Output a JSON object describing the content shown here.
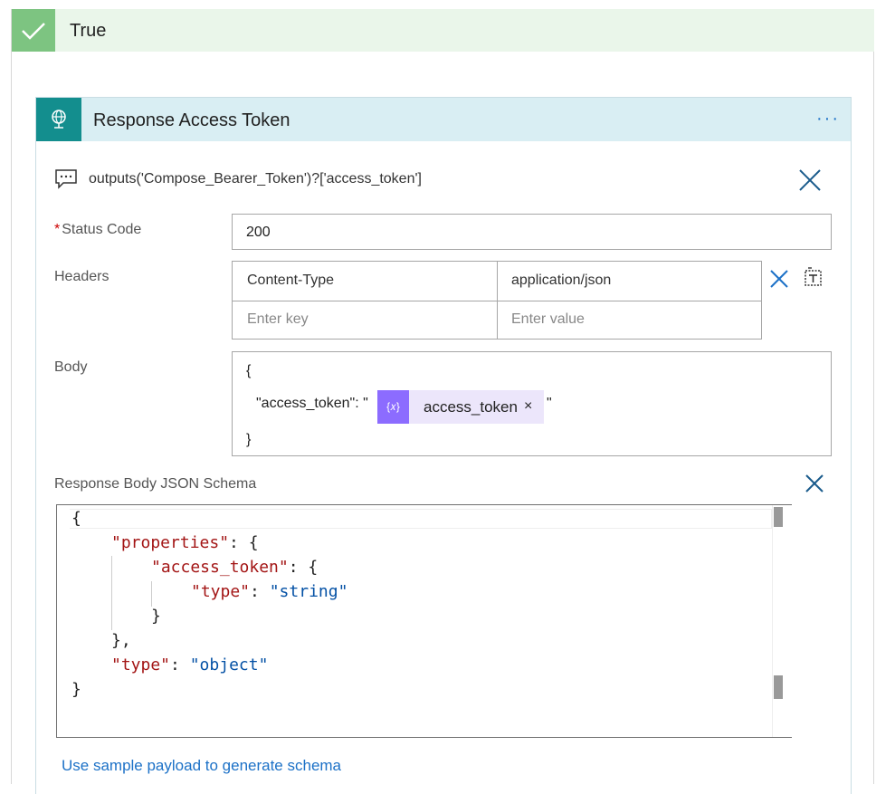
{
  "condition": {
    "label": "True"
  },
  "action": {
    "title": "Response Access Token",
    "menu": "···",
    "comment": "outputs('Compose_Bearer_Token')?['access_token']"
  },
  "fields": {
    "status_code": {
      "label": "Status Code",
      "required_mark": "*",
      "value": "200"
    },
    "headers": {
      "label": "Headers",
      "rows": [
        {
          "key": "Content-Type",
          "value": "application/json"
        }
      ],
      "key_placeholder": "Enter key",
      "value_placeholder": "Enter value"
    },
    "body": {
      "label": "Body",
      "open_brace": "{",
      "prefix": "\"access_token\": \"",
      "token_icon": "{𝑥}",
      "token_label": "access_token",
      "token_remove": "×",
      "suffix": "\"",
      "close_brace": "}"
    },
    "schema": {
      "label": "Response Body JSON Schema",
      "lines": {
        "l1": "{",
        "l2_key": "\"properties\"",
        "l2_rest": ": {",
        "l3_key": "\"access_token\"",
        "l3_rest": ": {",
        "l4_key": "\"type\"",
        "l4_mid": ": ",
        "l4_val": "\"string\"",
        "l5": "}",
        "l6": "},",
        "l7_key": "\"type\"",
        "l7_mid": ": ",
        "l7_val": "\"object\"",
        "l8": "}"
      }
    }
  },
  "generate_link": "Use sample payload to generate schema",
  "icons": {
    "check": "check-icon",
    "globe": "globe-icon",
    "comment": "comment-icon",
    "close": "close-icon",
    "switch_mode": "text-mode-icon"
  },
  "colors": {
    "true_header_bg": "#eaf6ea",
    "check_bg": "#7dc481",
    "card_header_bg": "#d9eef3",
    "card_icon_bg": "#138e8e",
    "token_bg": "#ece6fb",
    "token_icon_bg": "#8c6cff",
    "link": "#1c71c7"
  }
}
